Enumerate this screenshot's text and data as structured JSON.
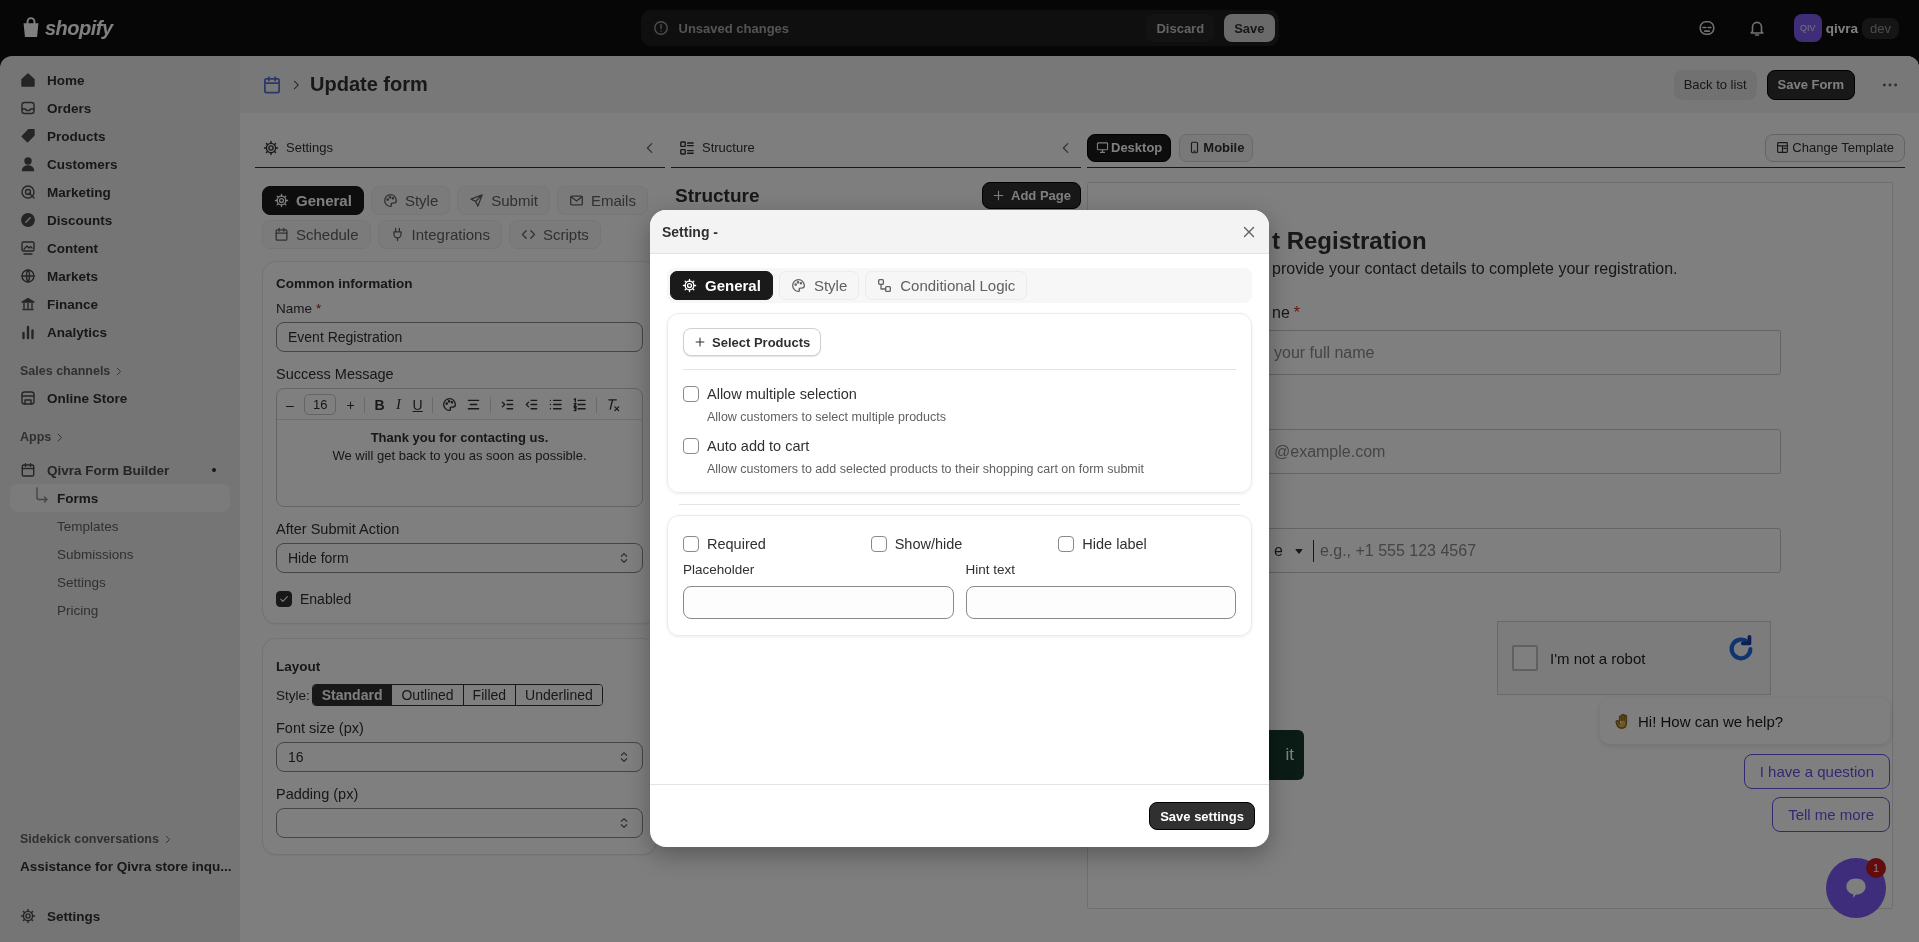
{
  "top_bar": {
    "logo": "shopify",
    "unsaved_bar": {
      "message": "Unsaved changes",
      "discard": "Discard",
      "save": "Save"
    },
    "account": {
      "avatar": "QIV",
      "store": "qivra",
      "badge": "dev"
    }
  },
  "sidebar": {
    "items": [
      {
        "label": "Home",
        "selected": false
      },
      {
        "label": "Orders",
        "selected": false
      },
      {
        "label": "Products",
        "selected": false
      },
      {
        "label": "Customers",
        "selected": false
      },
      {
        "label": "Marketing",
        "selected": false
      },
      {
        "label": "Discounts",
        "selected": false
      },
      {
        "label": "Content",
        "selected": false
      },
      {
        "label": "Markets",
        "selected": false
      },
      {
        "label": "Finance",
        "selected": false
      },
      {
        "label": "Analytics",
        "selected": false
      }
    ],
    "sales_channels": {
      "heading": "Sales channels",
      "items": [
        {
          "label": "Online Store",
          "selected": false
        }
      ]
    },
    "apps": {
      "heading": "Apps",
      "app": {
        "label": "Qivra Form Builder",
        "children": [
          {
            "label": "Forms",
            "selected": true
          },
          {
            "label": "Templates",
            "selected": false
          },
          {
            "label": "Submissions",
            "selected": false
          },
          {
            "label": "Settings",
            "selected": false
          },
          {
            "label": "Pricing",
            "selected": false
          }
        ]
      }
    },
    "sidekick": {
      "heading": "Sidekick conversations",
      "items": [
        "Assistance for Qivra store inqu..."
      ]
    },
    "settings": "Settings"
  },
  "page_header": {
    "title": "Update form",
    "back": "Back to list",
    "save": "Save Form"
  },
  "settings_panel": {
    "title": "Settings",
    "tabs": [
      {
        "label": "General",
        "selected": true
      },
      {
        "label": "Style",
        "selected": false
      },
      {
        "label": "Submit",
        "selected": false
      },
      {
        "label": "Emails",
        "selected": false
      },
      {
        "label": "Schedule",
        "selected": false
      },
      {
        "label": "Integrations",
        "selected": false
      },
      {
        "label": "Scripts",
        "selected": false
      }
    ],
    "common_information": {
      "heading": "Common information",
      "name": {
        "label": "Name",
        "required_mark": "*",
        "value": "Event Registration"
      },
      "success_message": {
        "label": "Success Message",
        "toolbar": {
          "decrease": "–",
          "size": "16",
          "increase": "+",
          "format": [
            "B",
            "I",
            "U"
          ]
        },
        "paragraphs": [
          {
            "text": "Thank you for contacting us.",
            "bold": true
          },
          {
            "text": "We will get back to you as soon as possible.",
            "bold": false
          }
        ]
      },
      "after_submit": {
        "label": "After Submit Action",
        "value": "Hide form"
      },
      "enabled": {
        "label": "Enabled",
        "checked": true
      }
    },
    "layout": {
      "heading": "Layout",
      "style_label": "Style:",
      "styles": [
        {
          "label": "Standard",
          "selected": true
        },
        {
          "label": "Outlined",
          "selected": false
        },
        {
          "label": "Filled",
          "selected": false
        },
        {
          "label": "Underlined",
          "selected": false
        }
      ],
      "font_size": {
        "label": "Font size (px)",
        "value": "16"
      },
      "padding": {
        "label": "Padding (px)"
      }
    }
  },
  "structure_panel": {
    "title": "Structure",
    "heading": "Structure",
    "add_button": "Add Page"
  },
  "preview": {
    "devices": [
      {
        "label": "Desktop",
        "selected": true
      },
      {
        "label": "Mobile",
        "selected": false
      }
    ],
    "change_template": "Change Template",
    "form": {
      "title": "t Registration",
      "description": "provide your contact details to complete your registration.",
      "fields": [
        {
          "kind": "text",
          "label": "ne",
          "required_mark": "*",
          "placeholder": "your full name"
        },
        {
          "kind": "text",
          "placeholder": "@example.com"
        },
        {
          "kind": "phone",
          "country": "e",
          "placeholder": "e.g., +1 555 123 4567"
        }
      ],
      "captcha": "I'm not a robot",
      "captcha_checked": false,
      "submit": "it"
    }
  },
  "chat_widget": {
    "greeting": "Hi! How can we help?",
    "options": [
      "I have a question",
      "Tell me more"
    ],
    "badge": "1"
  },
  "modal": {
    "title": "Setting -",
    "tabs": [
      {
        "label": "General",
        "selected": true
      },
      {
        "label": "Style",
        "selected": false
      },
      {
        "label": "Conditional Logic",
        "selected": false
      }
    ],
    "select_products": "Select Products",
    "options": [
      {
        "label": "Allow multiple selection",
        "description": "Allow customers to select multiple products",
        "checked": false
      },
      {
        "label": "Auto add to cart",
        "description": "Allow customers to add selected products to their shopping cart on form submit",
        "checked": false
      }
    ],
    "toggles": [
      {
        "label": "Required",
        "checked": false
      },
      {
        "label": "Show/hide",
        "checked": false
      },
      {
        "label": "Hide label",
        "checked": false
      }
    ],
    "fields": [
      {
        "label": "Placeholder"
      },
      {
        "label": "Hint text"
      }
    ],
    "save": "Save settings"
  }
}
